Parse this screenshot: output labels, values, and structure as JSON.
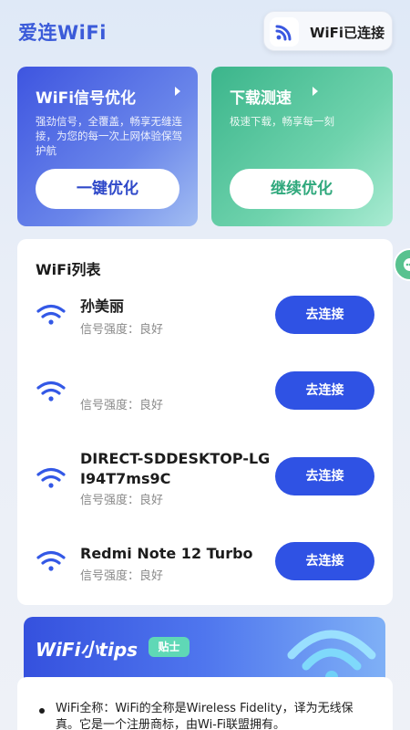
{
  "header": {
    "app_title": "爱连WiFi",
    "status_label": "WiFi已连接",
    "status_icon": "wifi-signal-icon"
  },
  "cards": {
    "optimize": {
      "title": "WiFi信号优化",
      "description": "强劲信号，全覆盖，畅享无缝连接，为您的每一次上网体验保驾护航",
      "button": "一键优化"
    },
    "speed": {
      "title": "下载测速",
      "description": "极速下载，畅享每一刻",
      "button": "继续优化"
    }
  },
  "wifi_list": {
    "title": "WiFi列表",
    "networks": [
      {
        "ssid": "孙美丽",
        "strength": "信号强度：良好",
        "button": "去连接"
      },
      {
        "ssid": "",
        "strength": "信号强度：良好",
        "button": "去连接"
      },
      {
        "ssid": "DIRECT-SDDESKTOP-LGI94T7ms9C",
        "strength": "信号强度：良好",
        "button": "去连接"
      },
      {
        "ssid": "Redmi Note 12 Turbo",
        "strength": "信号强度：良好",
        "button": "去连接"
      }
    ]
  },
  "tips": {
    "title": "WiFi小tips",
    "badge": "贴士",
    "text": "WiFi全称：WiFi的全称是Wireless Fidelity，译为无线保真。它是一个注册商标，由Wi-Fi联盟拥有。"
  },
  "colors": {
    "accent_blue": "#2f52e4",
    "brand_title": "#3b5bd9",
    "green_card": "#3bb58b",
    "tips_badge": "#5fd8b6"
  }
}
